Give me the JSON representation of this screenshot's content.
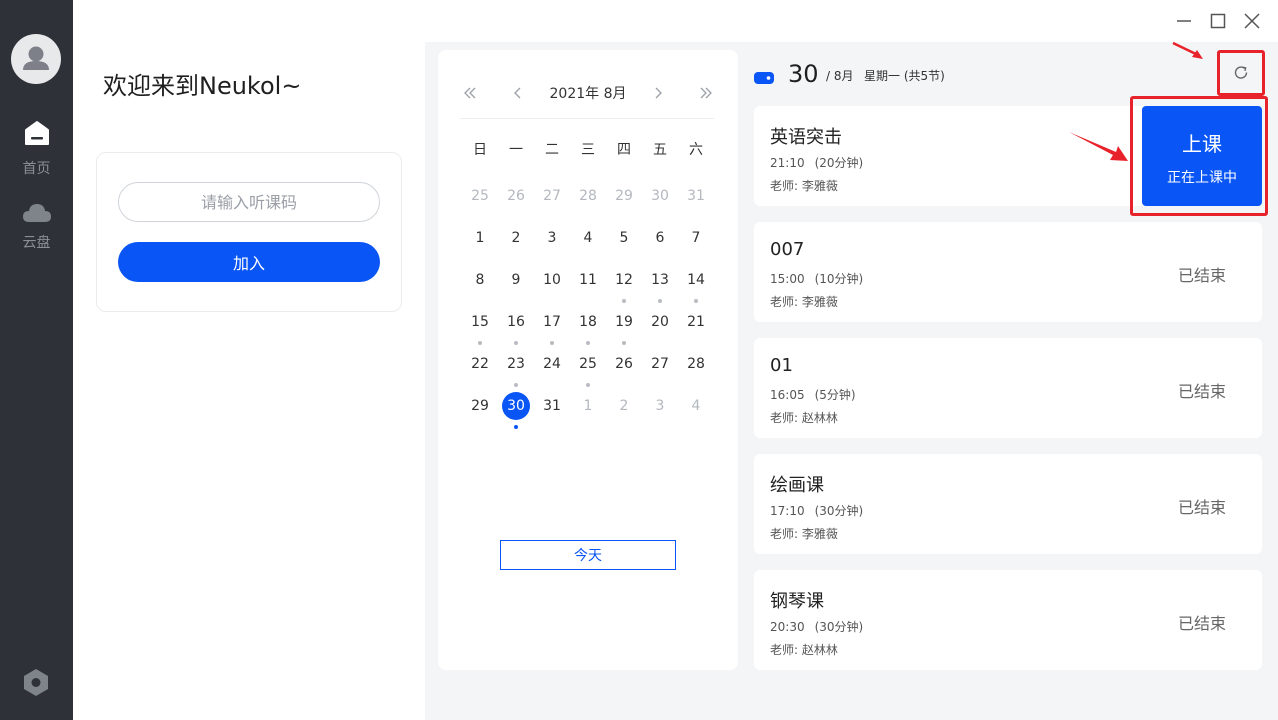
{
  "sidebar": {
    "items": [
      {
        "label": "首页",
        "icon": "home-icon",
        "active": true
      },
      {
        "label": "云盘",
        "icon": "cloud-icon",
        "active": false
      }
    ],
    "bottom_icon": "settings-hex-icon"
  },
  "window": {
    "controls": [
      "minimize-icon",
      "maximize-icon",
      "close-icon"
    ]
  },
  "welcome": "欢迎来到Neukol~",
  "join": {
    "placeholder": "请输入听课码",
    "button": "加入"
  },
  "calendar": {
    "title": "2021年 8月",
    "weekdays": [
      "日",
      "一",
      "二",
      "三",
      "四",
      "五",
      "六"
    ],
    "days": [
      [
        "25",
        "26",
        "27",
        "28",
        "29",
        "30",
        "31"
      ],
      [
        "1",
        "2",
        "3",
        "4",
        "5",
        "6",
        "7"
      ],
      [
        "8",
        "9",
        "10",
        "11",
        "12",
        "13",
        "14"
      ],
      [
        "15",
        "16",
        "17",
        "18",
        "19",
        "20",
        "21"
      ],
      [
        "22",
        "23",
        "24",
        "25",
        "26",
        "27",
        "28"
      ],
      [
        "29",
        "30",
        "31",
        "1",
        "2",
        "3",
        "4"
      ]
    ],
    "today_button": "今天",
    "selected": "30"
  },
  "schedule": {
    "day": "30",
    "month": "/ 8月",
    "weekday": "星期一 (共5节)",
    "lessons": [
      {
        "title": "英语突击",
        "time": "21:10",
        "duration": "(20分钟)",
        "teacher": "老师: 李雅薇",
        "status": "上课",
        "status_sub": "正在上课中"
      },
      {
        "title": "007",
        "time": "15:00",
        "duration": "(10分钟)",
        "teacher": "老师: 李雅薇",
        "status": "已结束"
      },
      {
        "title": "01",
        "time": "16:05",
        "duration": "(5分钟)",
        "teacher": "老师: 赵林林",
        "status": "已结束"
      },
      {
        "title": "绘画课",
        "time": "17:10",
        "duration": "(30分钟)",
        "teacher": "老师: 李雅薇",
        "status": "已结束"
      },
      {
        "title": "钢琴课",
        "time": "20:30",
        "duration": "(30分钟)",
        "teacher": "老师: 赵林林",
        "status": "已结束"
      }
    ]
  },
  "colors": {
    "accent": "#0a55f5",
    "sidebar": "#2e3138",
    "highlight": "#e8222a"
  }
}
